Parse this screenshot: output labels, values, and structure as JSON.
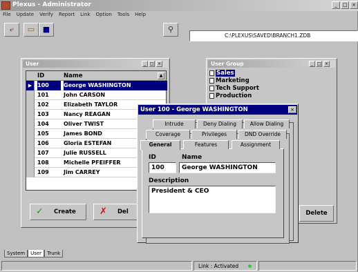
{
  "app": {
    "title": "Plexus - Administrator"
  },
  "menu": [
    "File",
    "Update",
    "Verify",
    "Report",
    "Link",
    "Option",
    "Tools",
    "Help"
  ],
  "path": "C:\\PLEXUS\\SAVED\\BRANCH1.ZDB",
  "user_window": {
    "title": "User",
    "columns": [
      "ID",
      "Name"
    ],
    "rows": [
      {
        "id": "100",
        "name": "George WASHINGTON"
      },
      {
        "id": "101",
        "name": "John CARSON"
      },
      {
        "id": "102",
        "name": "Elizabeth TAYLOR"
      },
      {
        "id": "103",
        "name": "Nancy REAGAN"
      },
      {
        "id": "104",
        "name": "Oliver TWIST"
      },
      {
        "id": "105",
        "name": "James BOND"
      },
      {
        "id": "106",
        "name": "Gloria ESTEFAN"
      },
      {
        "id": "107",
        "name": "Julie RUSSELL"
      },
      {
        "id": "108",
        "name": "Michelle PFEIFFER"
      },
      {
        "id": "109",
        "name": "Jim CARREY"
      }
    ],
    "create_label": "Create",
    "delete_label": "Del"
  },
  "group_window": {
    "title": "User Group",
    "items": [
      "Sales",
      "Marketing",
      "Tech Support",
      "Production"
    ],
    "delete_label": "Delete"
  },
  "dialog": {
    "title": "User 100 - George WASHINGTON",
    "tabs_row1": [
      "Intrude",
      "Deny Dialing",
      "Allow Dialing"
    ],
    "tabs_row2": [
      "Coverage",
      "Privileges",
      "DND Override"
    ],
    "tabs_row3": [
      "General",
      "Features",
      "Assignment"
    ],
    "id_label": "ID",
    "name_label": "Name",
    "id_value": "100",
    "name_value": "George WASHINGTON",
    "desc_label": "Description",
    "desc_value": "President & CEO"
  },
  "bottom_tabs": [
    "System",
    "User",
    "Trunk"
  ],
  "status": {
    "link": "Link : Activated"
  },
  "colors": {
    "selection": "#000080",
    "status_dot": "#2ecc40"
  }
}
